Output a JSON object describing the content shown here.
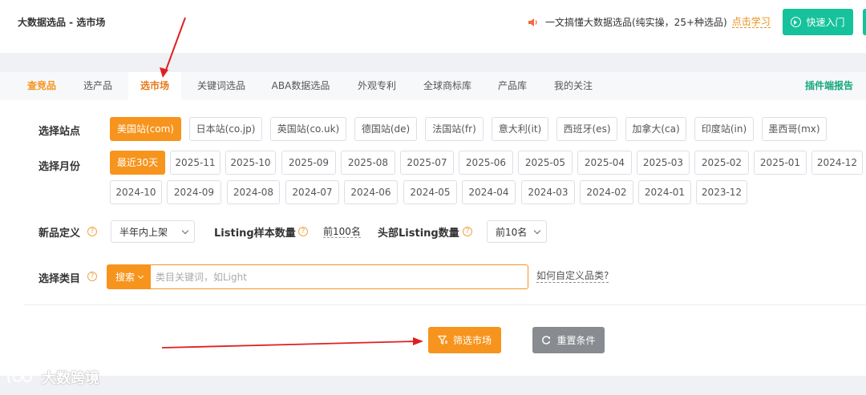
{
  "header": {
    "title": "大数据选品 - 选市场",
    "promo_text": "一文搞懂大数据选品(纯实操，25+种选品)",
    "promo_link": "点击学习",
    "quick_start": "快速入门"
  },
  "tabs": [
    {
      "label": "查竞品"
    },
    {
      "label": "选产品"
    },
    {
      "label": "选市场"
    },
    {
      "label": "关键词选品"
    },
    {
      "label": "ABA数据选品"
    },
    {
      "label": "外观专利"
    },
    {
      "label": "全球商标库"
    },
    {
      "label": "产品库"
    },
    {
      "label": "我的关注"
    },
    {
      "label": "插件端报告"
    }
  ],
  "site": {
    "label": "选择站点",
    "options": [
      "美国站(com)",
      "日本站(co.jp)",
      "英国站(co.uk)",
      "德国站(de)",
      "法国站(fr)",
      "意大利(it)",
      "西班牙(es)",
      "加拿大(ca)",
      "印度站(in)",
      "墨西哥(mx)"
    ],
    "selected": "美国站(com)"
  },
  "month": {
    "label": "选择月份",
    "row1": [
      "最近30天",
      "2025-11",
      "2025-10",
      "2025-09",
      "2025-08",
      "2025-07",
      "2025-06",
      "2025-05",
      "2025-04",
      "2025-03",
      "2025-02",
      "2025-01",
      "2024-12"
    ],
    "row2": [
      "2024-10",
      "2024-09",
      "2024-08",
      "2024-07",
      "2024-06",
      "2024-05",
      "2024-04",
      "2024-03",
      "2024-02",
      "2024-01",
      "2023-12"
    ],
    "selected": "最近30天"
  },
  "definition": {
    "label": "新品定义",
    "value": "半年内上架",
    "sample_label": "Listing样本数量",
    "sample_value": "前100名",
    "top_label": "头部Listing数量",
    "top_value": "前10名"
  },
  "category": {
    "label": "选择类目",
    "mode": "搜索",
    "placeholder": "类目关键词，如Light",
    "help_link": "如何自定义品类?"
  },
  "actions": {
    "filter": "筛选市场",
    "reset": "重置条件"
  },
  "watermark": "大数跨境",
  "colors": {
    "accent": "#f7941d",
    "green": "#16c29b",
    "gray_button": "#888b90",
    "annotation_arrow": "#e02020"
  }
}
